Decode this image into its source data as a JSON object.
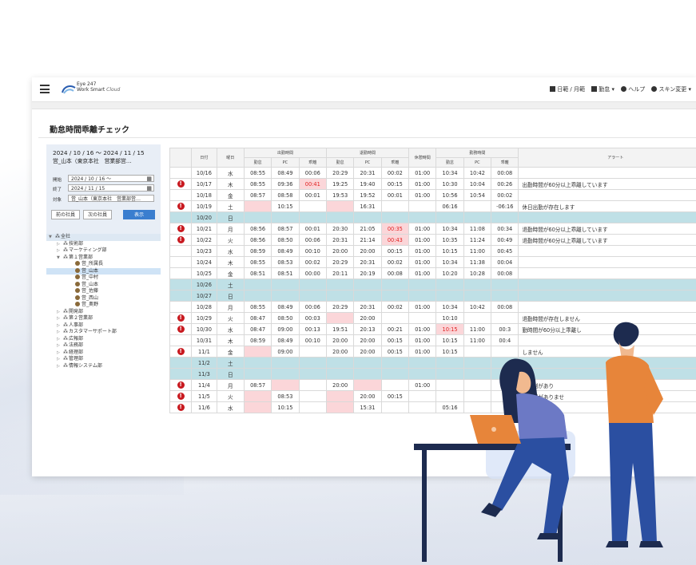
{
  "header": {
    "brand_top": "Eye 247",
    "brand_bottom": "Work Smart",
    "brand_suffix": "Cloud",
    "nav": {
      "daily": "日範 / 月範",
      "attendance": "勤怠 ▾",
      "help": "ヘルプ",
      "skin": "スキン変更 ▾"
    }
  },
  "page": {
    "title": "勤怠時間乖離チェック"
  },
  "filter": {
    "range": "2024 / 10 / 16 ～ 2024 / 11 / 15",
    "target_summary": "営_山本（東京本社　営業部営…",
    "start_label": "開始",
    "start_value": "2024 / 10 / 16 ～",
    "end_label": "終了",
    "end_value": "2024 / 11 / 15",
    "target_label": "対象",
    "target_value": "営_山本（東京本社　営業部営…",
    "prev_btn": "前の社員",
    "next_btn": "次の社員",
    "show_btn": "表示"
  },
  "tree": [
    {
      "label": "全社",
      "level": 0,
      "type": "org",
      "top": true
    },
    {
      "label": "技術部",
      "level": 1,
      "type": "org"
    },
    {
      "label": "マーケティング部",
      "level": 1,
      "type": "org"
    },
    {
      "label": "第１営業部",
      "level": 1,
      "type": "org",
      "open": true
    },
    {
      "label": "営_所属長",
      "level": 2,
      "type": "person"
    },
    {
      "label": "営_山本",
      "level": 2,
      "type": "person",
      "selected": true
    },
    {
      "label": "営_中村",
      "level": 2,
      "type": "person"
    },
    {
      "label": "営_山本",
      "level": 2,
      "type": "person"
    },
    {
      "label": "営_佐藤",
      "level": 2,
      "type": "person"
    },
    {
      "label": "営_西山",
      "level": 2,
      "type": "person"
    },
    {
      "label": "営_奥野",
      "level": 2,
      "type": "person"
    },
    {
      "label": "開発部",
      "level": 1,
      "type": "org"
    },
    {
      "label": "第２営業部",
      "level": 1,
      "type": "org"
    },
    {
      "label": "人事部",
      "level": 1,
      "type": "org"
    },
    {
      "label": "カスタマーサポート部",
      "level": 1,
      "type": "org"
    },
    {
      "label": "広報部",
      "level": 1,
      "type": "org"
    },
    {
      "label": "法務部",
      "level": 1,
      "type": "org"
    },
    {
      "label": "経理部",
      "level": 1,
      "type": "org"
    },
    {
      "label": "管理部",
      "level": 1,
      "type": "org"
    },
    {
      "label": "情報システム部",
      "level": 1,
      "type": "org"
    }
  ],
  "table": {
    "group_headers": {
      "date": "日付",
      "dow": "曜日",
      "in": "出勤時間",
      "out": "退勤時間",
      "break": "休憩時間",
      "work": "勤務時間",
      "alert": "アラート"
    },
    "sub_headers": [
      "勤怠",
      "PC",
      "乖離",
      "勤怠",
      "PC",
      "乖離",
      "勤怠",
      "PC",
      "乖離"
    ],
    "rows": [
      {
        "a": false,
        "d": "10/16",
        "w": "水",
        "c": [
          "08:55",
          "08:49",
          "00:06",
          "20:29",
          "20:31",
          "00:02",
          "01:00",
          "10:34",
          "10:42",
          "00:08"
        ],
        "msg": ""
      },
      {
        "a": true,
        "d": "10/17",
        "w": "木",
        "c": [
          "08:55",
          "09:36",
          "00:41",
          "19:25",
          "19:40",
          "00:15",
          "01:00",
          "10:30",
          "10:04",
          "00:26"
        ],
        "msg": "出勤時間が60分以上乖離しています",
        "pink": [
          2
        ],
        "red": [
          2
        ]
      },
      {
        "a": false,
        "d": "10/18",
        "w": "金",
        "c": [
          "08:57",
          "08:58",
          "00:01",
          "19:53",
          "19:52",
          "00:01",
          "01:00",
          "10:56",
          "10:54",
          "00:02"
        ],
        "msg": ""
      },
      {
        "a": true,
        "d": "10/19",
        "w": "土",
        "c": [
          "",
          "10:15",
          "",
          "",
          "16:31",
          "",
          "",
          "06:16",
          "",
          "-06:16"
        ],
        "msg": "休日出勤が存在します",
        "pink": [
          0,
          3
        ]
      },
      {
        "a": false,
        "d": "10/20",
        "w": "日",
        "c": [
          "",
          "",
          "",
          "",
          "",
          "",
          "",
          "",
          "",
          ""
        ],
        "msg": "",
        "hol": true
      },
      {
        "a": true,
        "d": "10/21",
        "w": "月",
        "c": [
          "08:56",
          "08:57",
          "00:01",
          "20:30",
          "21:05",
          "00:35",
          "01:00",
          "10:34",
          "11:08",
          "00:34"
        ],
        "msg": "退勤時間が60分以上乖離しています",
        "pink": [
          5
        ],
        "red": [
          5
        ]
      },
      {
        "a": true,
        "d": "10/22",
        "w": "火",
        "c": [
          "08:56",
          "08:50",
          "00:06",
          "20:31",
          "21:14",
          "00:43",
          "01:00",
          "10:35",
          "11:24",
          "00:49"
        ],
        "msg": "退勤時間が60分以上乖離しています",
        "pink": [
          5
        ],
        "red": [
          5
        ]
      },
      {
        "a": false,
        "d": "10/23",
        "w": "水",
        "c": [
          "08:59",
          "08:49",
          "00:10",
          "20:00",
          "20:00",
          "00:15",
          "01:00",
          "10:15",
          "11:00",
          "00:45"
        ],
        "msg": ""
      },
      {
        "a": false,
        "d": "10/24",
        "w": "木",
        "c": [
          "08:55",
          "08:53",
          "00:02",
          "20:29",
          "20:31",
          "00:02",
          "01:00",
          "10:34",
          "11:38",
          "00:04"
        ],
        "msg": ""
      },
      {
        "a": false,
        "d": "10/25",
        "w": "金",
        "c": [
          "08:51",
          "08:51",
          "00:00",
          "20:11",
          "20:19",
          "00:08",
          "01:00",
          "10:20",
          "10:28",
          "00:08"
        ],
        "msg": ""
      },
      {
        "a": false,
        "d": "10/26",
        "w": "土",
        "c": [
          "",
          "",
          "",
          "",
          "",
          "",
          "",
          "",
          "",
          ""
        ],
        "msg": "",
        "hol": true
      },
      {
        "a": false,
        "d": "10/27",
        "w": "日",
        "c": [
          "",
          "",
          "",
          "",
          "",
          "",
          "",
          "",
          "",
          ""
        ],
        "msg": "",
        "hol": true
      },
      {
        "a": false,
        "d": "10/28",
        "w": "月",
        "c": [
          "08:55",
          "08:49",
          "00:06",
          "20:29",
          "20:31",
          "00:02",
          "01:00",
          "10:34",
          "10:42",
          "00:08"
        ],
        "msg": ""
      },
      {
        "a": true,
        "d": "10/29",
        "w": "火",
        "c": [
          "08:47",
          "08:50",
          "00:03",
          "",
          "20:00",
          "",
          "",
          "10:10",
          "",
          ""
        ],
        "msg": "退勤時間が存在しません",
        "pink": [
          3
        ]
      },
      {
        "a": true,
        "d": "10/30",
        "w": "水",
        "c": [
          "08:47",
          "09:00",
          "00:13",
          "19:51",
          "20:13",
          "00:21",
          "01:00",
          "10:15",
          "11:00",
          "00:3"
        ],
        "msg": "勤時間が60分以上乖離し",
        "pink": [
          7
        ],
        "red": [
          7
        ]
      },
      {
        "a": false,
        "d": "10/31",
        "w": "木",
        "c": [
          "08:59",
          "08:49",
          "00:10",
          "20:00",
          "20:00",
          "00:15",
          "01:00",
          "10:15",
          "11:00",
          "00:4"
        ],
        "msg": ""
      },
      {
        "a": true,
        "d": "11/1",
        "w": "金",
        "c": [
          "",
          "09:00",
          "",
          "20:00",
          "20:00",
          "00:15",
          "01:00",
          "10:15",
          "",
          ""
        ],
        "msg": "しません",
        "pink": [
          0
        ]
      },
      {
        "a": false,
        "d": "11/2",
        "w": "土",
        "c": [
          "",
          "",
          "",
          "",
          "",
          "",
          "",
          "",
          "",
          ""
        ],
        "msg": "",
        "hol": true
      },
      {
        "a": false,
        "d": "11/3",
        "w": "日",
        "c": [
          "",
          "",
          "",
          "",
          "",
          "",
          "",
          "",
          "",
          ""
        ],
        "msg": "",
        "hol": true
      },
      {
        "a": true,
        "d": "11/4",
        "w": "月",
        "c": [
          "08:57",
          "",
          "",
          "20:00",
          "",
          "",
          "01:00",
          "",
          "",
          ""
        ],
        "msg": "了時刻があり",
        "pink": [
          1,
          4
        ]
      },
      {
        "a": true,
        "d": "11/5",
        "w": "火",
        "c": [
          "",
          "08:53",
          "",
          "",
          "20:00",
          "00:15",
          "",
          "",
          "",
          ""
        ],
        "msg": "了時刻がありませ",
        "pink": [
          0,
          3
        ]
      },
      {
        "a": true,
        "d": "11/6",
        "w": "水",
        "c": [
          "",
          "10:15",
          "",
          "",
          "15:31",
          "",
          "",
          "05:16",
          "",
          ""
        ],
        "msg": "",
        "pink": [
          0,
          3
        ]
      }
    ]
  },
  "colors": {
    "holiday": "#bfe0e6",
    "deviation": "#fbd6d9",
    "alert": "#c8191f",
    "accent": "#3a7ecf"
  }
}
